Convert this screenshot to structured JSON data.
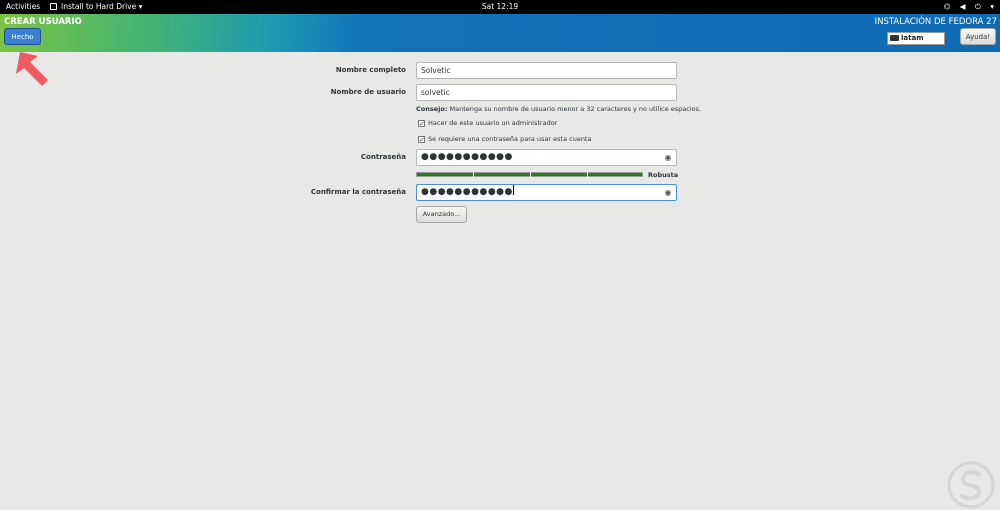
{
  "topbar": {
    "activities": "Activities",
    "app_menu": "Install to Hard Drive",
    "clock": "Sat 12:19",
    "tray_icons": [
      "network-icon",
      "volume-icon",
      "power-icon",
      "chevron-down-icon"
    ]
  },
  "header": {
    "title": "CREAR USUARIO",
    "done_label": "Hecho",
    "install_title": "INSTALACIÓN DE FEDORA 27",
    "keyboard_layout": "latam",
    "help_label": "Ayuda!"
  },
  "form": {
    "fullname_label": "Nombre completo",
    "fullname_value": "Solvetic",
    "username_label": "Nombre de usuario",
    "username_value": "solvetic",
    "hint_prefix": "Consejo:",
    "hint_text": "Mantenga su nombre de usuario menor a 32 caracteres y no utilice espacios.",
    "admin_checkbox_label": "Hacer de este usuario un administrador",
    "admin_checked": true,
    "password_required_label": "Se requiere una contraseña para usar esta cuenta",
    "password_required_checked": true,
    "password_label": "Contraseña",
    "password_value": "●●●●●●●●●●●",
    "strength_label": "Robusta",
    "strength_fraction": 1.0,
    "confirm_label": "Confirmar la contraseña",
    "confirm_value": "●●●●●●●●●●●",
    "advanced_label": "Avanzado..."
  },
  "colors": {
    "header_blue": "#0e6ab5",
    "header_green": "#7cc443",
    "done_button": "#3b7fd4",
    "arrow": "#f05a5e",
    "strength": "#2d7a1e"
  }
}
